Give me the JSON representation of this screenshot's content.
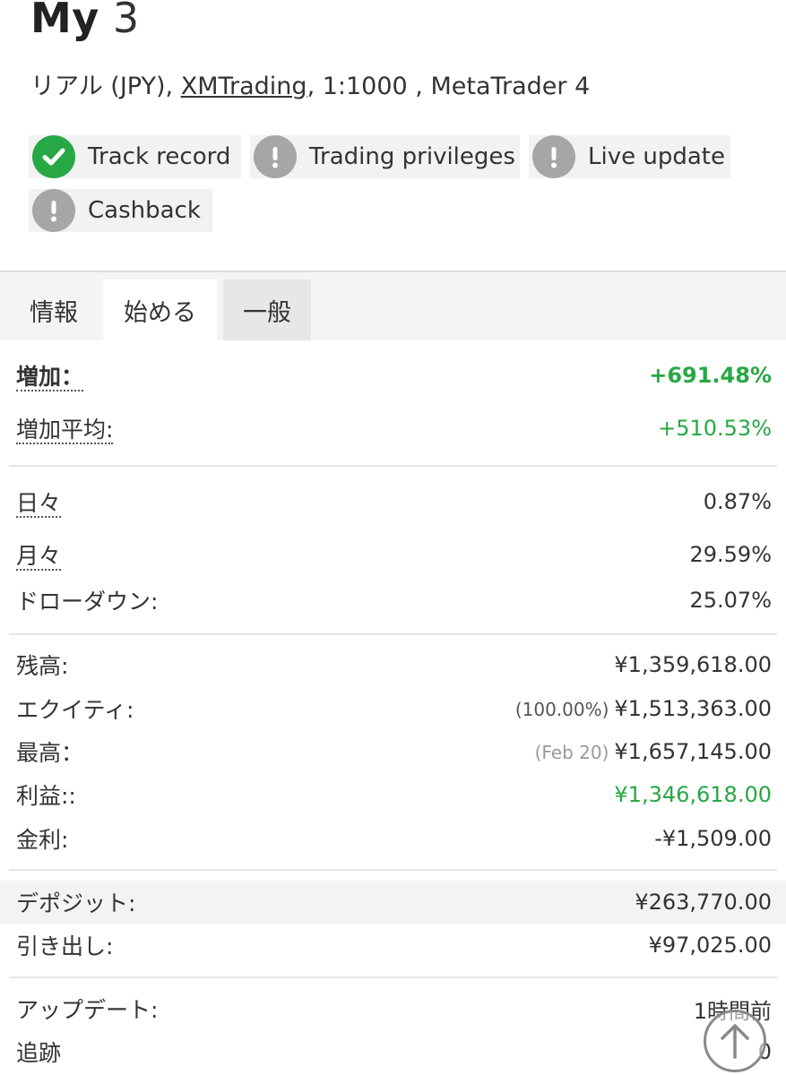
{
  "account": {
    "name_bold": "My",
    "name_light": "3",
    "sub_prefix": "リアル (JPY), ",
    "broker": "XMTrading",
    "sub_suffix": ", 1:1000 , MetaTrader 4"
  },
  "badges": [
    {
      "label": "Track record",
      "status": "verified",
      "icon": "check-icon",
      "color": "#27a844"
    },
    {
      "label": "Trading privileges",
      "status": "unverified",
      "icon": "exclamation-icon",
      "color": "#a6a6a6"
    },
    {
      "label": "Live update",
      "status": "unverified",
      "icon": "exclamation-icon",
      "color": "#a6a6a6"
    },
    {
      "label": "Cashback",
      "status": "unverified",
      "icon": "exclamation-icon",
      "color": "#a6a6a6"
    }
  ],
  "tabs": [
    {
      "label": "情報",
      "state": "inactive"
    },
    {
      "label": "始める",
      "state": "active"
    },
    {
      "label": "一般",
      "state": "inactive"
    }
  ],
  "stats": {
    "gain_label": "増加：",
    "gain_value": "+691.48%",
    "abs_gain_label": "増加平均:",
    "abs_gain_value": "+510.53%",
    "daily_label": "日々",
    "daily_value": "0.87%",
    "monthly_label": "月々",
    "monthly_value": "29.59%",
    "drawdown_label": "ドローダウン:",
    "drawdown_value": "25.07%",
    "balance_label": "残高:",
    "balance_value": "¥1,359,618.00",
    "equity_label": "エクイティ:",
    "equity_pct": "(100.00%)",
    "equity_value": "¥1,513,363.00",
    "highest_label": "最高：",
    "highest_date": "(Feb 20)",
    "highest_value": "¥1,657,145.00",
    "profit_label": "利益::",
    "profit_value": "¥1,346,618.00",
    "interest_label": "金利:",
    "interest_value": "-¥1,509.00",
    "deposits_label": "デポジット:",
    "deposits_value": "¥263,770.00",
    "withdrawals_label": "引き出し:",
    "withdrawals_value": "¥97,025.00",
    "updated_label": "アップデート:",
    "updated_value": "1時間前",
    "tracking_label": "追跡",
    "tracking_value": "0"
  },
  "colors": {
    "positive": "#27a844",
    "badge_ok": "#27a844",
    "badge_warn": "#a6a6a6"
  }
}
